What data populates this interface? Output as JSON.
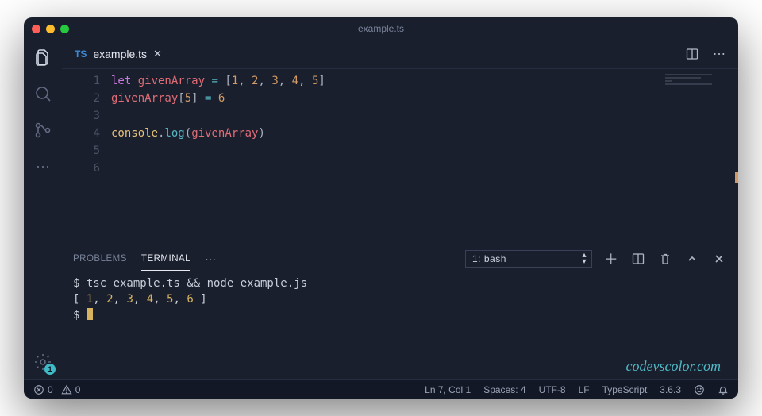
{
  "titlebar": {
    "title": "example.ts"
  },
  "tab": {
    "lang_badge": "TS",
    "filename": "example.ts",
    "close_glyph": "✕"
  },
  "tab_actions": {
    "more_glyph": "⋯"
  },
  "activity": {
    "more_glyph": "⋯",
    "settings_badge": "1"
  },
  "editor": {
    "lines": [
      "1",
      "2",
      "3",
      "4",
      "5",
      "6"
    ],
    "code_tokens": [
      [
        {
          "t": "let ",
          "c": "tok-kw"
        },
        {
          "t": "givenArray",
          "c": "tok-var"
        },
        {
          "t": " ",
          "c": ""
        },
        {
          "t": "=",
          "c": "tok-op"
        },
        {
          "t": " [",
          "c": "tok-punc"
        },
        {
          "t": "1",
          "c": "tok-num"
        },
        {
          "t": ", ",
          "c": "tok-punc"
        },
        {
          "t": "2",
          "c": "tok-num"
        },
        {
          "t": ", ",
          "c": "tok-punc"
        },
        {
          "t": "3",
          "c": "tok-num"
        },
        {
          "t": ", ",
          "c": "tok-punc"
        },
        {
          "t": "4",
          "c": "tok-num"
        },
        {
          "t": ", ",
          "c": "tok-punc"
        },
        {
          "t": "5",
          "c": "tok-num"
        },
        {
          "t": "]",
          "c": "tok-punc"
        }
      ],
      [
        {
          "t": "givenArray",
          "c": "tok-var"
        },
        {
          "t": "[",
          "c": "tok-punc"
        },
        {
          "t": "5",
          "c": "tok-num"
        },
        {
          "t": "] ",
          "c": "tok-punc"
        },
        {
          "t": "=",
          "c": "tok-op"
        },
        {
          "t": " ",
          "c": ""
        },
        {
          "t": "6",
          "c": "tok-num"
        }
      ],
      [],
      [
        {
          "t": "console",
          "c": "tok-obj"
        },
        {
          "t": ".",
          "c": "tok-punc"
        },
        {
          "t": "log",
          "c": "tok-fn"
        },
        {
          "t": "(",
          "c": "tok-punc"
        },
        {
          "t": "givenArray",
          "c": "tok-var"
        },
        {
          "t": ")",
          "c": "tok-punc"
        }
      ],
      [],
      []
    ]
  },
  "panel": {
    "tabs": {
      "problems": "PROBLEMS",
      "terminal": "TERMINAL",
      "more_glyph": "⋯"
    },
    "terminal_select": "1: bash",
    "plus_glyph": "＋",
    "body": {
      "prompt": "$",
      "cmd": "tsc example.ts && node example.js",
      "output_open": "[ ",
      "output_nums": [
        "1",
        "2",
        "3",
        "4",
        "5",
        "6"
      ],
      "output_sep": ", ",
      "output_close": " ]"
    }
  },
  "status": {
    "errors": "0",
    "warnings": "0",
    "ln_col": "Ln 7, Col 1",
    "spaces": "Spaces: 4",
    "encoding": "UTF-8",
    "eol": "LF",
    "language": "TypeScript",
    "version": "3.6.3"
  },
  "watermark": "codevscolor.com"
}
